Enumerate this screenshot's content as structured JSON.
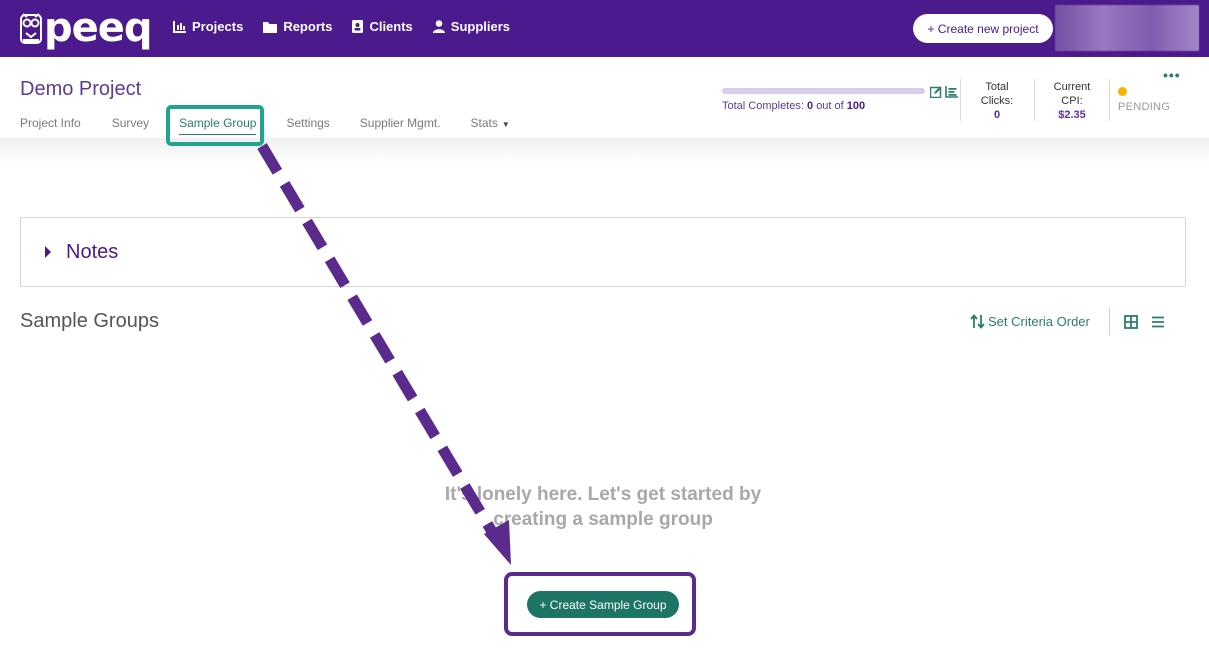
{
  "brand": {
    "name": "peeq"
  },
  "nav": {
    "items": [
      {
        "label": "Projects",
        "icon": "bar-chart-icon"
      },
      {
        "label": "Reports",
        "icon": "folder-icon"
      },
      {
        "label": "Clients",
        "icon": "contact-card-icon"
      },
      {
        "label": "Suppliers",
        "icon": "user-icon"
      }
    ]
  },
  "header": {
    "create_project_label": "+ Create new project"
  },
  "project": {
    "title": "Demo Project"
  },
  "tabs": [
    {
      "label": "Project Info"
    },
    {
      "label": "Survey"
    },
    {
      "label": "Sample Group",
      "active": true
    },
    {
      "label": "Settings"
    },
    {
      "label": "Supplier Mgmt."
    },
    {
      "label": "Stats"
    }
  ],
  "progress": {
    "label": "Total Completes:",
    "completed": "0",
    "out_of": "out of",
    "total": "100",
    "fraction": 0
  },
  "metrics": {
    "clicks": {
      "label1": "Total",
      "label2": "Clicks:",
      "value": "0"
    },
    "cpi": {
      "label1": "Current",
      "label2": "CPI:",
      "value": "$2.35"
    }
  },
  "status": {
    "label": "PENDING",
    "color": "#f5b400"
  },
  "notes": {
    "title": "Notes"
  },
  "sample_groups": {
    "title": "Sample Groups",
    "criteria_label": "Set Criteria Order",
    "empty_line1": "It's lonely here. Let's get started by",
    "empty_line2": "creating a sample group",
    "create_label": "+ Create Sample Group"
  },
  "colors": {
    "primary": "#4b1a8c",
    "accent": "#2a7d6f",
    "highlight_tab": "#1fa58c",
    "highlight_button": "#5a2a8c"
  }
}
